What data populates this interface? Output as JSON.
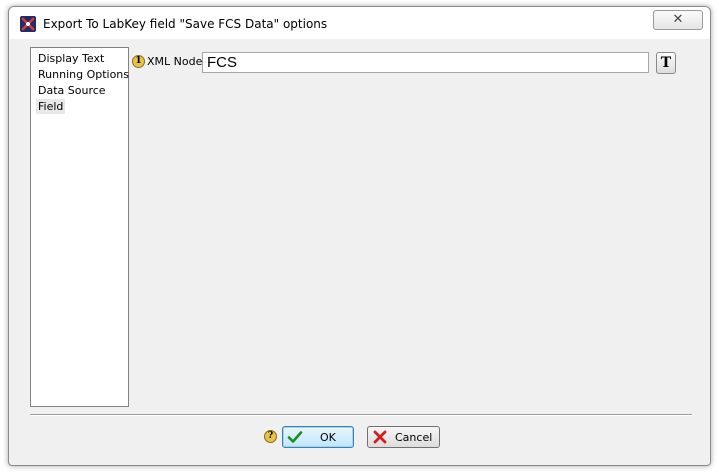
{
  "window": {
    "title": "Export To LabKey field \"Save FCS Data\" options",
    "close_glyph": "✕",
    "app_icon": "flowjo-x-icon"
  },
  "nav": {
    "items": [
      {
        "label": "Display Text",
        "selected": false
      },
      {
        "label": "Running Options",
        "selected": false
      },
      {
        "label": "Data Source",
        "selected": false
      },
      {
        "label": "Field",
        "selected": true
      }
    ]
  },
  "field": {
    "help_marker": "1",
    "label": "XML Node",
    "value": "FCS",
    "text_button_label": "T"
  },
  "footer": {
    "help_marker": "?",
    "ok_label": "OK",
    "cancel_label": "Cancel"
  },
  "colors": {
    "ok_check": "#1a8f1a",
    "cancel_x": "#d01e1e",
    "help_marker": "#e8c34a"
  }
}
